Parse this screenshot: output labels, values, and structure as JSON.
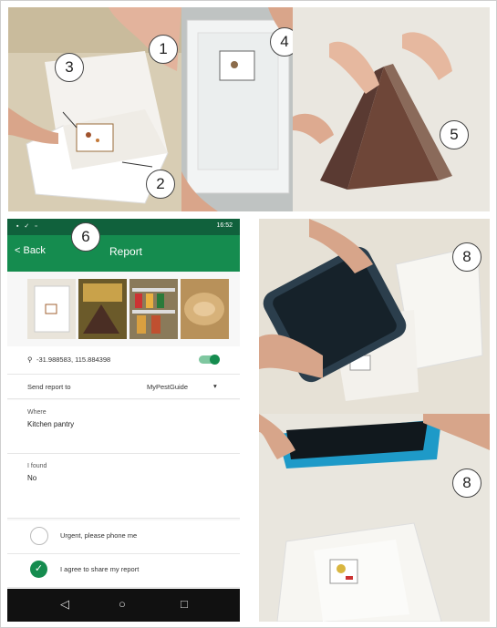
{
  "steps": {
    "s1": "1",
    "s2": "2",
    "s3": "3",
    "s4": "4",
    "s5": "5",
    "s6": "6",
    "s8a": "8",
    "s8b": "8"
  },
  "phone": {
    "status_time": "16:52",
    "back_label": "< Back",
    "title": "Report",
    "coordinates": "-31.988583, 115.884398",
    "send_to_label": "Send report to",
    "send_to_value": "MyPestGuide",
    "where_label": "Where",
    "where_value": "Kitchen pantry",
    "found_label": "I found",
    "found_value": "No",
    "urgent_label": "Urgent, please phone me",
    "agree_label": "I agree to share my report",
    "nav": {
      "back": "◁",
      "home": "○",
      "recent": "□"
    }
  },
  "colors": {
    "app_green": "#158c4f",
    "status_green": "#10613c"
  }
}
